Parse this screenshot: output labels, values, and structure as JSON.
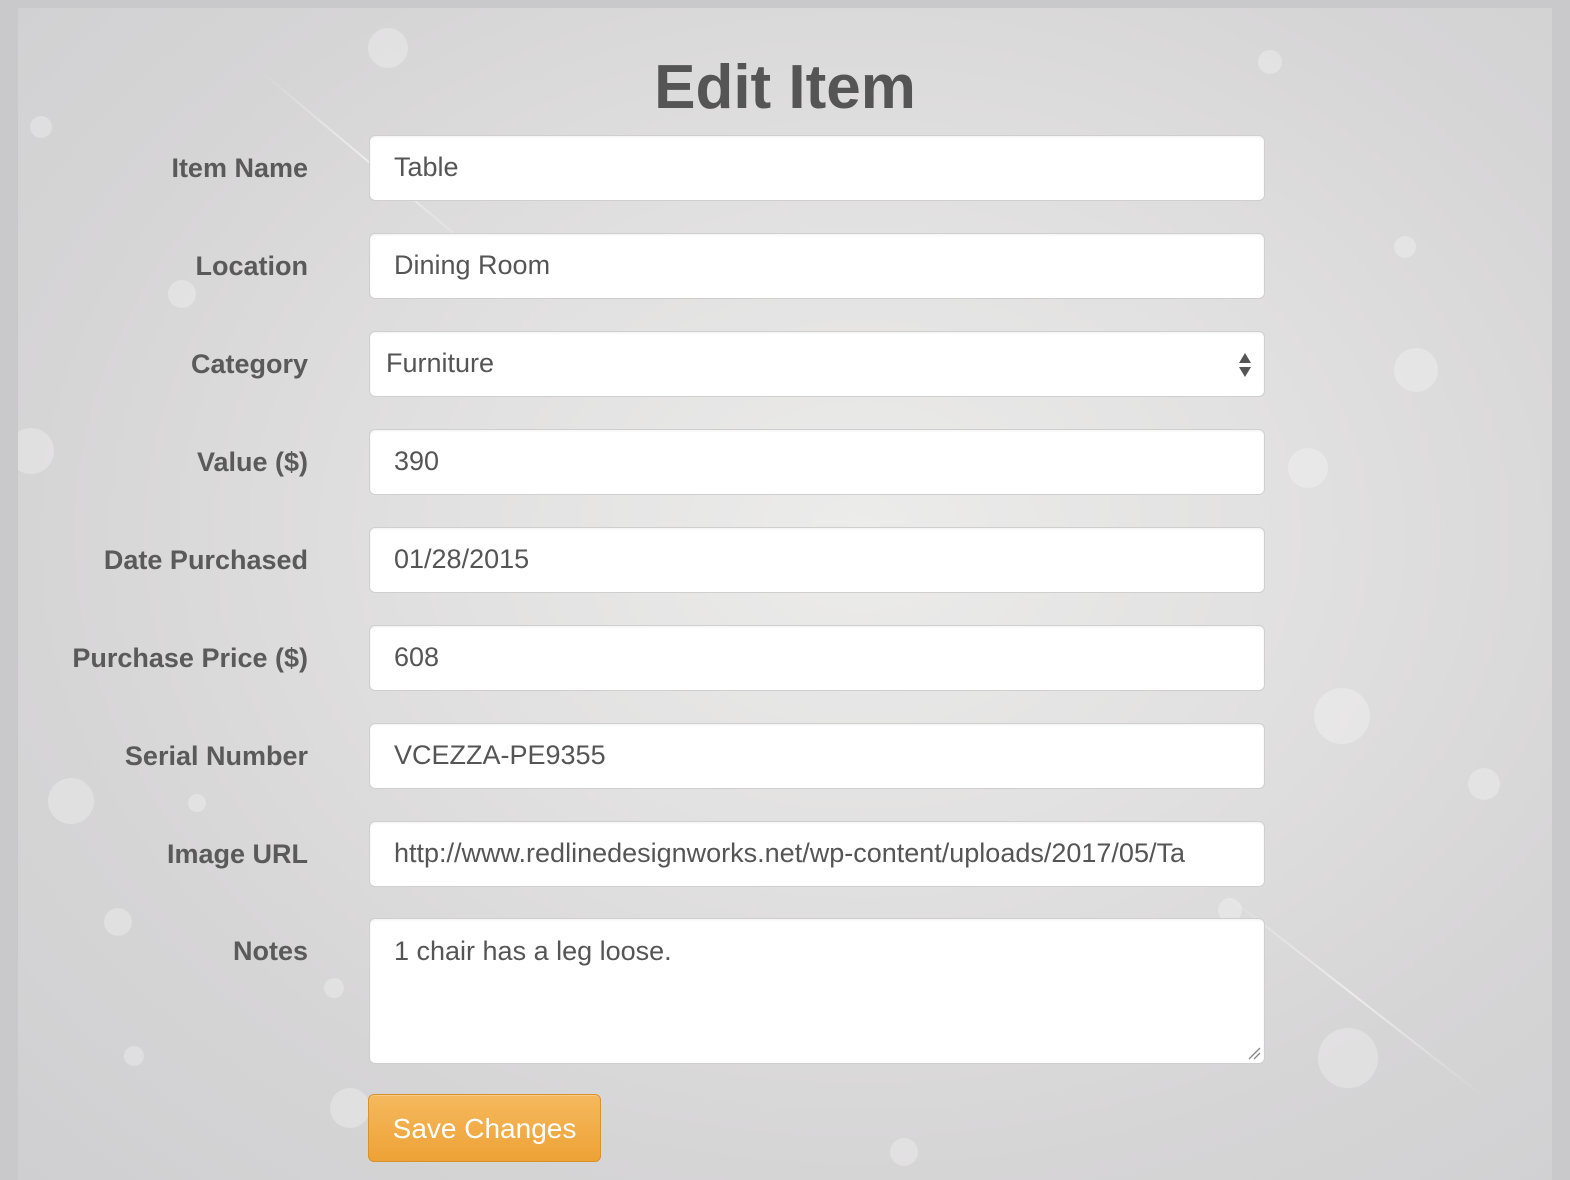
{
  "page": {
    "title": "Edit Item"
  },
  "form": {
    "item_name": {
      "label": "Item Name",
      "value": "Table"
    },
    "location": {
      "label": "Location",
      "value": "Dining Room"
    },
    "category": {
      "label": "Category",
      "value": "Furniture"
    },
    "value": {
      "label": "Value ($)",
      "value": "390"
    },
    "date_purchased": {
      "label": "Date Purchased",
      "value": "01/28/2015"
    },
    "purchase_price": {
      "label": "Purchase Price ($)",
      "value": "608"
    },
    "serial_number": {
      "label": "Serial Number",
      "value": "VCEZZA-PE9355"
    },
    "image_url": {
      "label": "Image URL",
      "value": "http://www.redlinedesignworks.net/wp-content/uploads/2017/05/Ta"
    },
    "notes": {
      "label": "Notes",
      "value": "1 chair has a leg loose."
    },
    "save_label": "Save Changes"
  },
  "icons": {
    "select_arrows": "select-arrows-icon",
    "resize_grip": "resize-grip-icon"
  },
  "colors": {
    "background": "#e2e1e1",
    "text": "#555555",
    "button": "#f0ad4e",
    "button_text": "#ffffff"
  }
}
